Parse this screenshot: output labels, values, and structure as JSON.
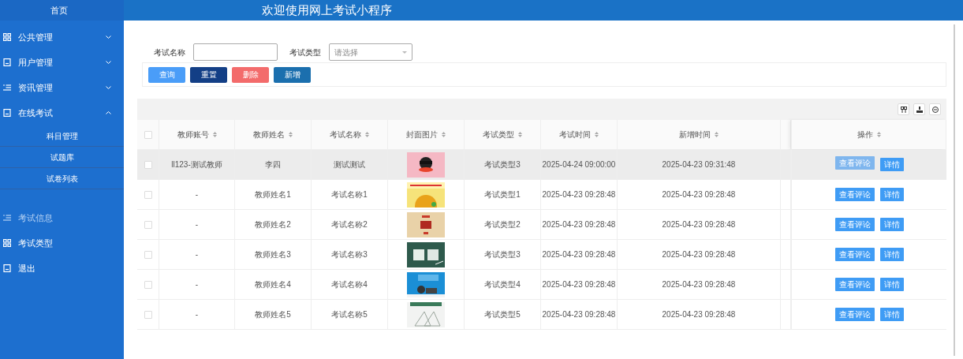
{
  "header": {
    "title": "欢迎使用网上考试小程序",
    "home": "首页"
  },
  "sidebar": {
    "items": [
      {
        "label": "公共管理",
        "expanded": false,
        "selected": false
      },
      {
        "label": "用户管理",
        "expanded": false,
        "selected": false
      },
      {
        "label": "资讯管理",
        "expanded": false,
        "selected": false
      },
      {
        "label": "在线考试",
        "expanded": true,
        "selected": false,
        "children": [
          {
            "label": "科目管理"
          },
          {
            "label": "试题库"
          },
          {
            "label": "试卷列表"
          }
        ]
      },
      {
        "label": "考试信息",
        "selected": true
      },
      {
        "label": "考试类型",
        "selected": false
      },
      {
        "label": "退出",
        "selected": false
      }
    ]
  },
  "search": {
    "fields": [
      {
        "label": "考试名称",
        "kind": "input"
      },
      {
        "label": "考试类型",
        "kind": "select",
        "placeholder": "请选择"
      }
    ],
    "buttons": [
      {
        "label": "查询",
        "color": "#4a9df8"
      },
      {
        "label": "重置",
        "color": "#133f86"
      },
      {
        "label": "删除",
        "color": "#f36b6b"
      },
      {
        "label": "新增",
        "color": "#1b6fae"
      }
    ]
  },
  "table": {
    "select_all": {
      "checked": false
    },
    "columns": [
      "教师账号",
      "教师姓名",
      "考试名称",
      "封面图片",
      "考试类型",
      "考试时间",
      "新增时间",
      "操作"
    ],
    "rows": [
      {
        "checked": false,
        "hovered": true,
        "cells": [
          "ll123-测试教师",
          "李四",
          "测试测试",
          {
            "kind": "picture"
          },
          "考试类型3",
          "2025-04-24 09:00:00",
          "2025-04-23 09:31:48"
        ],
        "actions": [
          {
            "label": "查看评论",
            "hovered": true
          },
          {
            "label": "详情",
            "hovered": false
          }
        ]
      },
      {
        "checked": false,
        "hovered": false,
        "cells": [
          "-",
          "教师姓名1",
          "考试名称1",
          {
            "kind": "picture"
          },
          "考试类型1",
          "2025-04-23 09:28:48",
          "2025-04-23 09:28:48"
        ],
        "actions": [
          {
            "label": "查看评论",
            "hovered": false
          },
          {
            "label": "详情",
            "hovered": false
          }
        ]
      },
      {
        "checked": false,
        "hovered": false,
        "cells": [
          "-",
          "教师姓名2",
          "考试名称2",
          {
            "kind": "picture"
          },
          "考试类型2",
          "2025-04-23 09:28:48",
          "2025-04-23 09:28:48"
        ],
        "actions": [
          {
            "label": "查看评论",
            "hovered": false
          },
          {
            "label": "详情",
            "hovered": false
          }
        ]
      },
      {
        "checked": false,
        "hovered": false,
        "cells": [
          "-",
          "教师姓名3",
          "考试名称3",
          {
            "kind": "picture"
          },
          "考试类型3",
          "2025-04-23 09:28:48",
          "2025-04-23 09:28:48"
        ],
        "actions": [
          {
            "label": "查看评论",
            "hovered": false
          },
          {
            "label": "详情",
            "hovered": false
          }
        ]
      },
      {
        "checked": false,
        "hovered": false,
        "cells": [
          "-",
          "教师姓名4",
          "考试名称4",
          {
            "kind": "picture"
          },
          "考试类型4",
          "2025-04-23 09:28:48",
          "2025-04-23 09:28:48"
        ],
        "actions": [
          {
            "label": "查看评论",
            "hovered": false
          },
          {
            "label": "详情",
            "hovered": false
          }
        ]
      },
      {
        "checked": false,
        "hovered": false,
        "cells": [
          "-",
          "教师姓名5",
          "考试名称5",
          {
            "kind": "picture"
          },
          "考试类型5",
          "2025-04-23 09:28:48",
          "2025-04-23 09:28:48"
        ],
        "actions": [
          {
            "label": "查看评论",
            "hovered": false
          },
          {
            "label": "详情",
            "hovered": false
          }
        ]
      }
    ]
  }
}
